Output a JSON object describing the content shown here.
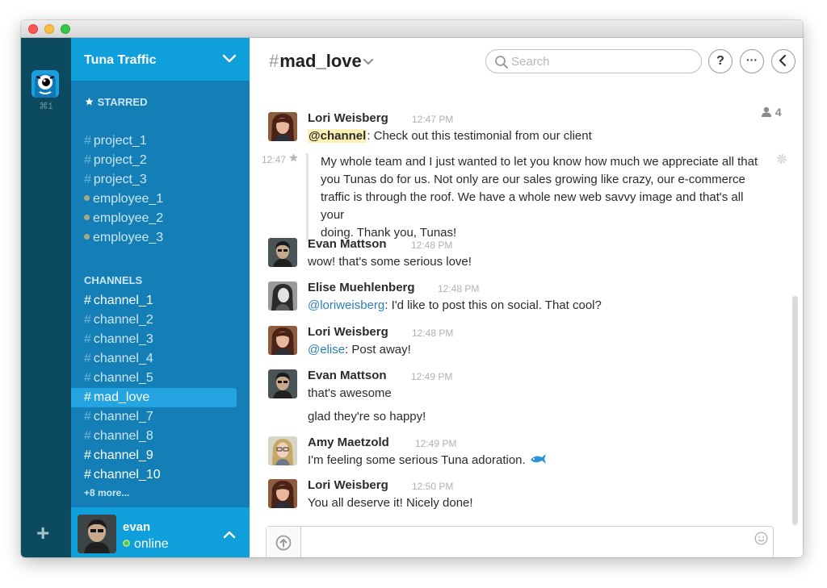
{
  "team": {
    "name": "Tuna Traffic",
    "shortcut": "⌘1",
    "add_symbol": "+"
  },
  "sidebar": {
    "starred_label": "STARRED",
    "starred": [
      {
        "type": "channel",
        "name": "project_1"
      },
      {
        "type": "channel",
        "name": "project_2"
      },
      {
        "type": "channel",
        "name": "project_3"
      },
      {
        "type": "dm",
        "name": "employee_1"
      },
      {
        "type": "dm",
        "name": "employee_2"
      },
      {
        "type": "dm",
        "name": "employee_3"
      }
    ],
    "channels_label": "CHANNELS",
    "channels": [
      {
        "name": "channel_1"
      },
      {
        "name": "channel_2"
      },
      {
        "name": "channel_3"
      },
      {
        "name": "channel_4"
      },
      {
        "name": "channel_5"
      },
      {
        "name": "mad_love"
      },
      {
        "name": "channel_7"
      },
      {
        "name": "channel_8"
      },
      {
        "name": "channel_9"
      },
      {
        "name": "channel_10"
      }
    ],
    "more_label": "+8 more..."
  },
  "user": {
    "name": "evan",
    "status": "online"
  },
  "header": {
    "channel_hash": "#",
    "channel_name": "mad_love",
    "search_placeholder": "Search",
    "help_label": "?",
    "more_label": "···",
    "member_count": "4"
  },
  "messages": [
    {
      "author": "Lori Weisberg",
      "time": "12:47 PM",
      "mention": "@channel",
      "text": ": Check out this testimonial from our client"
    },
    {
      "author": "Evan Mattson",
      "time": "12:48 PM",
      "text": "wow! that's some serious love!"
    },
    {
      "author": "Elise Muehlenberg",
      "time": "12:48 PM",
      "mention": "@loriweisberg",
      "text": ":  I'd like to post this on social. That cool?"
    },
    {
      "author": "Lori Weisberg",
      "time": "12:48 PM",
      "mention": "@elise",
      "text": ": Post away!"
    },
    {
      "author": "Evan Mattson",
      "time": "12:49 PM",
      "text": "that's awesome",
      "text2": "glad they're so happy!"
    },
    {
      "author": "Amy Maetzold",
      "time": "12:49 PM",
      "text": "I'm feeling some serious Tuna adoration."
    },
    {
      "author": "Lori Weisberg",
      "time": "12:50 PM",
      "text": "You all deserve it! Nicely done!"
    }
  ],
  "quote": {
    "time": "12:47",
    "lines": [
      "My whole team and I just wanted to let you know how much we appreciate all that",
      "you Tunas do for us. Not only are our sales growing like crazy, our e-commerce",
      "traffic is through the roof. We have a whole new web savvy image and that's all your",
      "doing. Thank you, Tunas!"
    ]
  },
  "colors": {
    "team_rail": "#0c4b5f",
    "sidebar": "#137fb6",
    "sidebar_header": "#0f9fda",
    "active_channel": "#25a4e2",
    "mention": "#2a80b9",
    "channel_mention_highlight": "#fcf1b2",
    "online": "#3fc35a"
  },
  "icons": {
    "team_logo": "tuna-monster-logo",
    "search": "magnifier",
    "back": "chevron-left",
    "star": "star",
    "gear": "gear",
    "upload": "arrow-up-circle",
    "emoji": "smiley",
    "member": "person",
    "tuna": "blue-fish"
  }
}
